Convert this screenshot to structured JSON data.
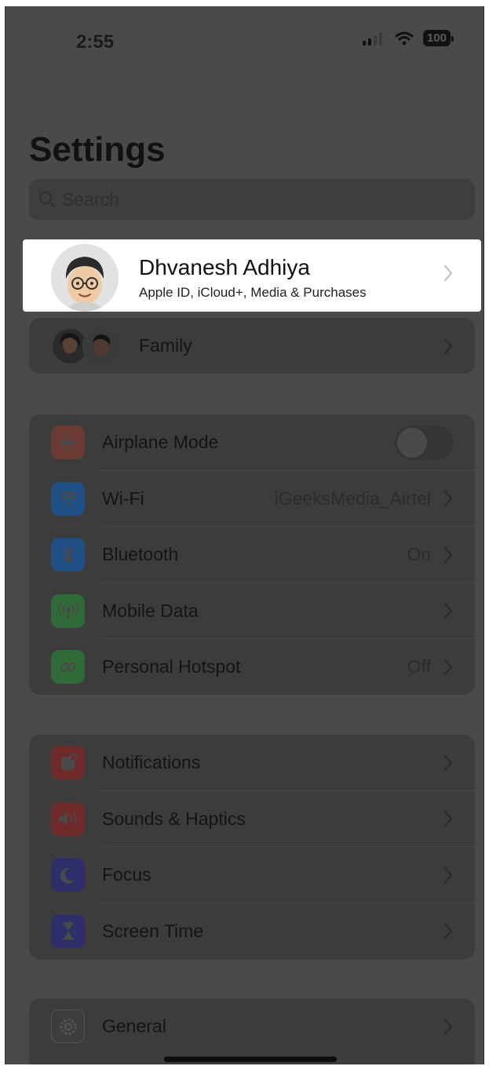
{
  "status_bar": {
    "time": "2:55",
    "battery": "100"
  },
  "page_title": "Settings",
  "search": {
    "placeholder": "Search"
  },
  "profile": {
    "name": "Dhvanesh Adhiya",
    "subtitle": "Apple ID, iCloud+, Media & Purchases"
  },
  "family": {
    "label": "Family"
  },
  "connectivity": [
    {
      "label": "Airplane Mode",
      "value": "",
      "icon": "airplane-icon",
      "color": "#6b3a33"
    },
    {
      "label": "Wi-Fi",
      "value": "iGeeksMedia_Airtel",
      "icon": "wifi-icon",
      "color": "#1f4f85"
    },
    {
      "label": "Bluetooth",
      "value": "On",
      "icon": "bluetooth-icon",
      "color": "#1f4f85"
    },
    {
      "label": "Mobile Data",
      "value": "",
      "icon": "antenna-icon",
      "color": "#2f6a38"
    },
    {
      "label": "Personal Hotspot",
      "value": "Off",
      "icon": "hotspot-icon",
      "color": "#2f6a38"
    }
  ],
  "alerts": [
    {
      "label": "Notifications",
      "icon": "bell-icon",
      "color": "#6f2a2a"
    },
    {
      "label": "Sounds & Haptics",
      "icon": "speaker-icon",
      "color": "#6f2a2a"
    },
    {
      "label": "Focus",
      "icon": "moon-icon",
      "color": "#2e2e6a"
    },
    {
      "label": "Screen Time",
      "icon": "hourglass-icon",
      "color": "#2e2e6a"
    }
  ],
  "general": {
    "label": "General",
    "icon": "gear-icon",
    "color": "#3d3d3d"
  },
  "airplane_mode_on": false
}
